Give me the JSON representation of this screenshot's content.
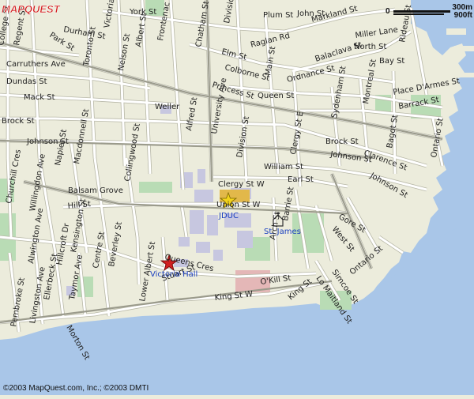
{
  "brand": {
    "logo_text": "MAPQUEST",
    "logo_color": "#d32020"
  },
  "scale": {
    "zero": "0",
    "metric": "300m",
    "imperial": "900ft"
  },
  "copyright": "©2003 MapQuest.com, Inc.; ©2003 DMTI",
  "colors": {
    "land": "#ececdc",
    "water": "#a9c6e8",
    "park": "#b9dcb5",
    "campus": "#c7c7e0",
    "road": "#ffffff"
  },
  "markers": [
    {
      "kind": "star",
      "color": "#f2d21a",
      "label": "JDUC"
    },
    {
      "kind": "star",
      "color": "#d02020",
      "label": "Victoria Hall"
    },
    {
      "kind": "church",
      "color": "#333333",
      "label": "St. James"
    }
  ],
  "streets": [
    "York St",
    "Plum St",
    "John St",
    "Markland St",
    "Durham St",
    "Park St",
    "Raglan Rd",
    "Elm St",
    "Carruthers Ave",
    "Colborne St",
    "Ordnance St",
    "Balaclava St",
    "Miller Lane",
    "North St",
    "Bay St",
    "Dundas St",
    "Queen St",
    "Place D'Armes St",
    "Barrack St",
    "Princess St",
    "Mack St",
    "Weller",
    "Brock St",
    "Johnson St",
    "Clergy St E",
    "Brock St",
    "Johnson St",
    "Clarence St",
    "William St",
    "Earl St",
    "Clergy St W",
    "Union St W",
    "Balsam Grove",
    "Hill St",
    "Queens Cres",
    "Johnson St",
    "Gore St",
    "West St",
    "Ontario St",
    "Lower Albert St",
    "Stuart St",
    "King St W",
    "O'Kill St",
    "King St",
    "Simcoe St",
    "Lo Maitland St",
    "College St",
    "Regent St",
    "Victoria St",
    "Albert St",
    "Frontenac St",
    "Nelson St",
    "Toronto St",
    "Chatham St",
    "Division St",
    "Main St",
    "Rideau St",
    "Alfred St",
    "University Ave",
    "Division St",
    "Montreal St",
    "Sydenham St",
    "Bagot St",
    "Ontario St",
    "Churchill Cres",
    "Willingdon Ave",
    "Napier St",
    "Macdonnell St",
    "Collingwood St",
    "Barrie St",
    "Arch St",
    "Kensington St",
    "Beverley St",
    "Centre St",
    "Hillcroft Dr",
    "Alwington Ave",
    "Ellerbeck St",
    "Livingston Ave",
    "Pembroke St",
    "Morton St",
    "Taymor Ave"
  ]
}
